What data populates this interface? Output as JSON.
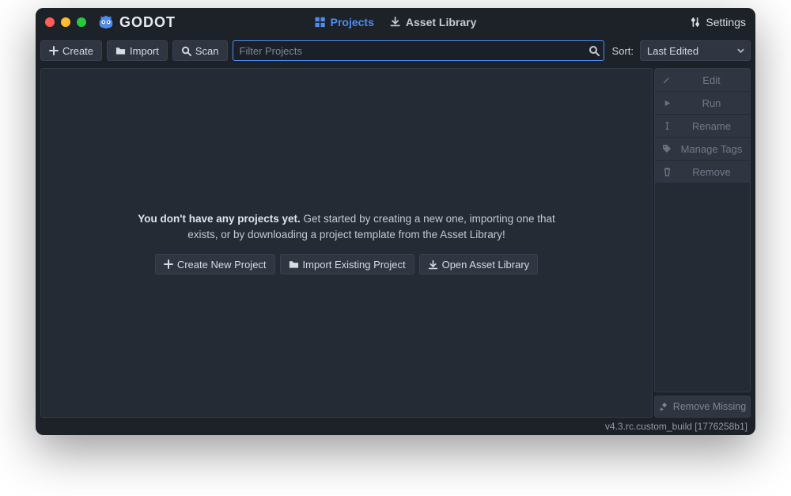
{
  "app": {
    "name": "GODOT"
  },
  "tabs": {
    "projects": "Projects",
    "asset_library": "Asset Library"
  },
  "header": {
    "settings": "Settings"
  },
  "toolbar": {
    "create": "Create",
    "import": "Import",
    "scan": "Scan",
    "filter_placeholder": "Filter Projects",
    "sort_label": "Sort:",
    "sort_value": "Last Edited"
  },
  "empty_state": {
    "bold": "You don't have any projects yet.",
    "rest": " Get started by creating a new one, importing one that exists, or by downloading a project template from the Asset Library!",
    "create_btn": "Create New Project",
    "import_btn": "Import Existing Project",
    "asset_btn": "Open Asset Library"
  },
  "side": {
    "edit": "Edit",
    "run": "Run",
    "rename": "Rename",
    "manage_tags": "Manage Tags",
    "remove": "Remove",
    "remove_missing": "Remove Missing"
  },
  "footer": {
    "version": "v4.3.rc.custom_build [1776258b1]"
  }
}
